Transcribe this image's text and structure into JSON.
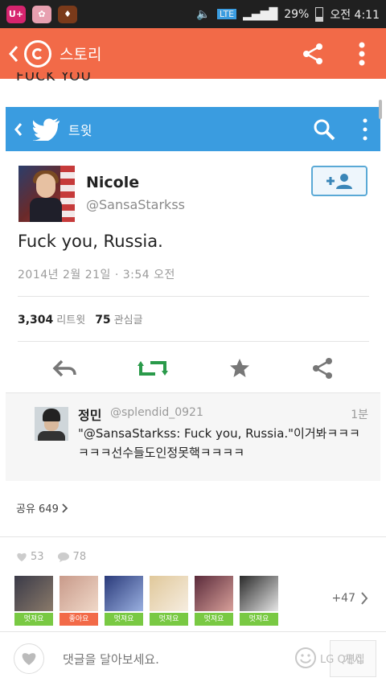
{
  "status_bar": {
    "carrier": "U+",
    "network": "LTE",
    "battery": "29%",
    "time": "오전 4:11"
  },
  "app_bar": {
    "title": "스토리"
  },
  "story": {
    "cut_text": "FUCK YOU"
  },
  "twitter_bar": {
    "title": "트윗"
  },
  "tweet": {
    "name": "Nicole",
    "handle": "@SansaStarkss",
    "text": "Fuck you, Russia.",
    "date": "2014년 2월 21일 · 3:54 오전",
    "retweets": "3,304",
    "retweets_label": "리트윗",
    "favorites": "75",
    "favorites_label": "관심글"
  },
  "reply": {
    "name": "정민",
    "handle": "@splendid_0921",
    "time": "1분",
    "text": "\"@SansaStarkss: Fuck you, Russia.\"이거봐ㅋㅋㅋㅋㅋㅋ선수들도인정못핵ㅋㅋㅋㅋ"
  },
  "share": {
    "label": "공유 649"
  },
  "counts": {
    "likes": "53",
    "comments": "78"
  },
  "likers": [
    {
      "tag": "멋져요",
      "color": "green"
    },
    {
      "tag": "좋아요",
      "color": "orange"
    },
    {
      "tag": "멋져요",
      "color": "green"
    },
    {
      "tag": "멋져요",
      "color": "green"
    },
    {
      "tag": "멋져요",
      "color": "green"
    },
    {
      "tag": "멋져요",
      "color": "green"
    }
  ],
  "likers_more": "+47",
  "comment": {
    "placeholder": "댓글을 달아보세요.",
    "submit_label": "게시",
    "watermark": "LG Q편집"
  },
  "colors": {
    "app_bar": "#f26a48",
    "twitter_bar": "#3a9ce0",
    "retweet_green": "#2a9a4a"
  }
}
